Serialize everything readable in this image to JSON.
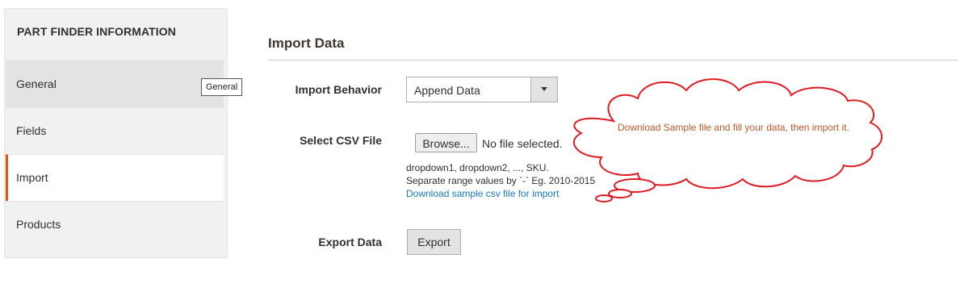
{
  "sidebar": {
    "title": "PART FINDER INFORMATION",
    "items": [
      {
        "label": "General",
        "state": "hovered"
      },
      {
        "label": "Fields",
        "state": "normal"
      },
      {
        "label": "Import",
        "state": "active"
      },
      {
        "label": "Products",
        "state": "normal"
      }
    ],
    "tooltip": "General"
  },
  "main": {
    "section_title": "Import Data",
    "import_behavior": {
      "label": "Import Behavior",
      "selected": "Append Data"
    },
    "csv_file": {
      "label": "Select CSV File",
      "browse_label": "Browse...",
      "no_file_text": "No file selected.",
      "note_line1": "dropdown1, dropdown2, ..., SKU.",
      "note_line2": "Separate range values by `-` Eg. 2010-2015",
      "sample_link": "Download sample csv file for import"
    },
    "export": {
      "label": "Export Data",
      "button_label": "Export"
    }
  },
  "callout": {
    "text": "Download Sample file and fill your data, then import it.",
    "stroke_color": "#e01b24",
    "text_color": "#c0582a"
  },
  "colors": {
    "active_accent": "#eb5202",
    "link": "#1979c3"
  }
}
